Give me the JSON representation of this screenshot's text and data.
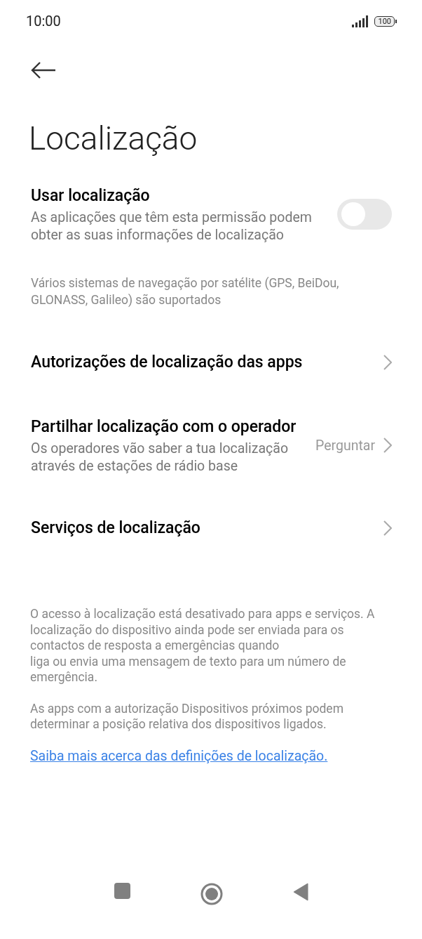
{
  "status_bar": {
    "time": "10:00",
    "battery": "100"
  },
  "title": "Localização",
  "items": [
    {
      "kind": "toggle",
      "title": "Usar localização",
      "subtitle": "As aplicações que têm esta permissão podem obter as suas informações de localização",
      "on": false
    },
    {
      "kind": "note",
      "text": "Vários sistemas de navegação por satélite (GPS, BeiDou, GLONASS, Galileo) são suportados"
    },
    {
      "kind": "link",
      "title": "Autorizações de localização das apps"
    },
    {
      "kind": "value",
      "title": "Partilhar localização com o operador",
      "subtitle": "Os operadores vão saber a tua localização através de estações de rádio base",
      "value": "Perguntar"
    },
    {
      "kind": "link",
      "title": "Serviços de localização"
    }
  ],
  "footer": {
    "paragraphs": [
      "O acesso à localização está desativado para apps e serviços. A localização do dispositivo ainda pode ser enviada para os contactos de resposta a emergências quando\nliga ou envia uma mensagem de texto para um número de emergência.",
      "As apps com a autorização Dispositivos próximos podem determinar a posição relativa dos dispositivos ligados."
    ],
    "link": "Saiba mais acerca das definições de localização."
  }
}
